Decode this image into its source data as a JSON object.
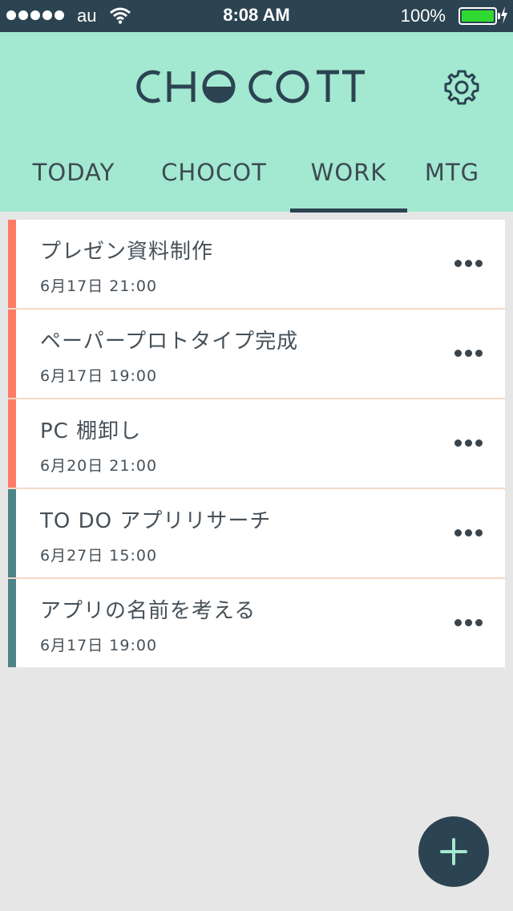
{
  "status_bar": {
    "carrier": "au",
    "time": "8:08 AM",
    "battery_percent": "100%",
    "battery_level": 1.0,
    "battery_color": "#2fd92f"
  },
  "header": {
    "app_title": "CHOCOTTO",
    "settings_icon": "gear-icon",
    "background_color": "#a3e8d0"
  },
  "tabs": [
    {
      "label": "TODAY",
      "selected": false
    },
    {
      "label": "CHOCOT",
      "selected": false
    },
    {
      "label": "WORK",
      "selected": true
    },
    {
      "label": "MTG",
      "selected": false
    }
  ],
  "tasks": [
    {
      "title": "プレゼン資料制作",
      "date": "6月17日 21:00",
      "accent_color": "#ff7b64"
    },
    {
      "title": "ペーパープロトタイプ完成",
      "date": "6月17日 19:00",
      "accent_color": "#ff7b64"
    },
    {
      "title": "PC 棚卸し",
      "date": "6月20日 21:00",
      "accent_color": "#ff7b64"
    },
    {
      "title": "TO DO アプリリサーチ",
      "date": "6月27日 15:00",
      "accent_color": "#4d8389"
    },
    {
      "title": "アプリの名前を考える",
      "date": "6月17日 19:00",
      "accent_color": "#4d8389"
    }
  ],
  "fab": {
    "icon": "plus-icon",
    "icon_color": "#a3e8d0"
  },
  "colors": {
    "navy": "#2c4352",
    "background": "#e6e6e6"
  }
}
